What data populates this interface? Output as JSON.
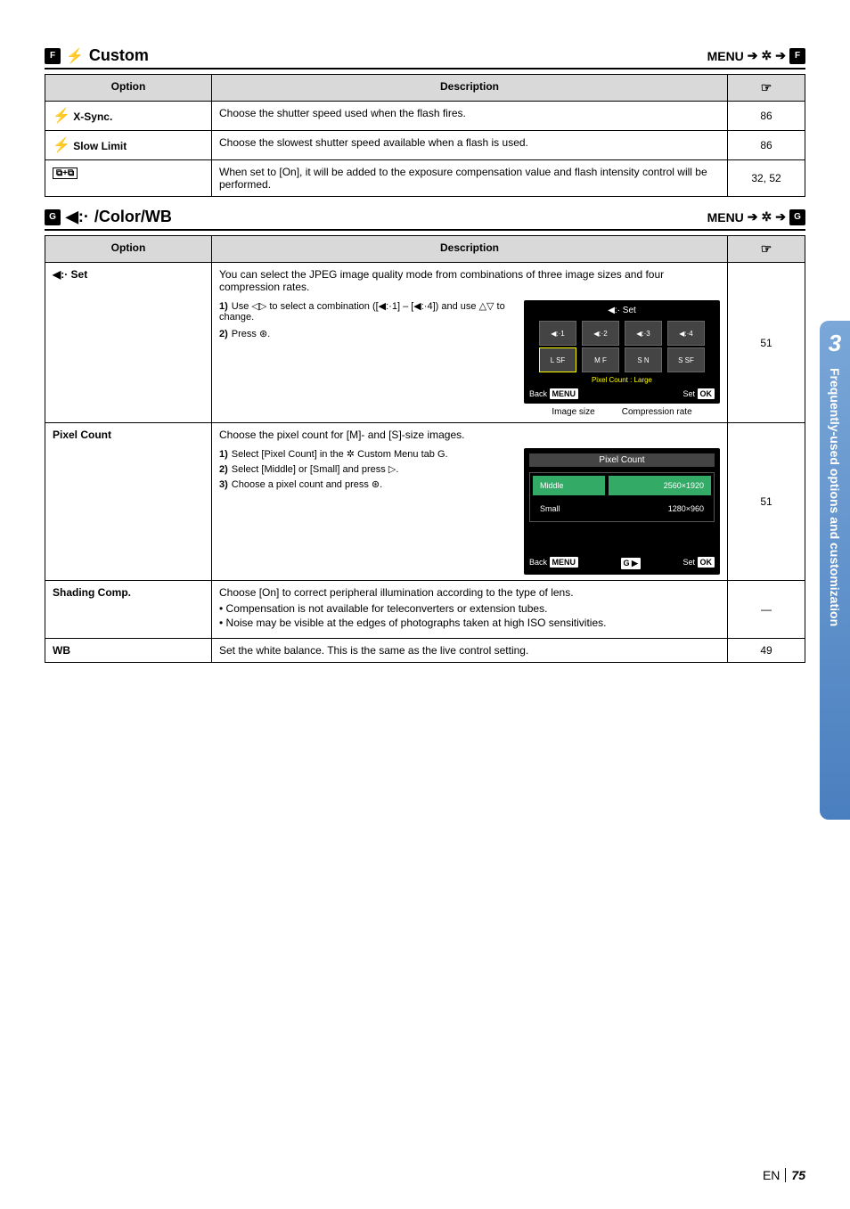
{
  "sectionF": {
    "tabIcon": "F",
    "flashIcon": "⚡",
    "title": "Custom",
    "menu": {
      "text": "MENU",
      "wrench": "✲",
      "tabIcon": "F"
    },
    "headers": {
      "option": "Option",
      "description": "Description",
      "ref": "☞"
    },
    "rows": [
      {
        "optIcon": "⚡",
        "opt": "X-Sync.",
        "desc": "Choose the shutter speed used when the flash fires.",
        "ref": "86"
      },
      {
        "optIcon": "⚡",
        "opt": "Slow Limit",
        "desc": "Choose the slowest shutter speed available when a flash is used.",
        "ref": "86"
      },
      {
        "optIcon": "",
        "opt": "⧉+⧉",
        "desc": "When set to [On], it will be added to the exposure compensation value and flash intensity control will be performed.",
        "ref": "32, 52"
      }
    ]
  },
  "sectionG": {
    "tabIcon": "G",
    "setIcon": "◀:·",
    "title": "/Color/WB",
    "menu": {
      "text": "MENU",
      "wrench": "✲",
      "tabIcon": "G"
    },
    "headers": {
      "option": "Option",
      "description": "Description",
      "ref": "☞"
    },
    "rows": {
      "set": {
        "opt": "◀:· Set",
        "desc": "You can select the JPEG image quality mode from combinations of three image sizes and four compression rates.",
        "steps": [
          {
            "n": "1)",
            "t": "Use ◁▷ to select a combination ([◀:·1] – [◀:·4]) and use △▽ to change."
          },
          {
            "n": "2)",
            "t": "Press ⊛."
          }
        ],
        "screen": {
          "title": "◀:· Set",
          "cells": [
            "◀:·1",
            "◀:·2",
            "◀:·3",
            "◀:·4",
            "L SF",
            "M F",
            "S N",
            "S SF"
          ],
          "pixelLine": "Pixel Count : Large",
          "back": "Back",
          "backBtn": "MENU",
          "set": "Set",
          "setBtn": "OK"
        },
        "captions": {
          "left": "Image size",
          "right": "Compression rate"
        },
        "ref": "51"
      },
      "pixelCount": {
        "opt": "Pixel Count",
        "desc": "Choose the pixel count for [M]- and [S]-size images.",
        "steps": [
          {
            "n": "1)",
            "t": "Select [Pixel Count] in the ✲ Custom Menu tab G."
          },
          {
            "n": "2)",
            "t": "Select [Middle] or [Small] and press ▷."
          },
          {
            "n": "3)",
            "t": "Choose a pixel count and press ⊛."
          }
        ],
        "screen": {
          "title": "Pixel Count",
          "rows": [
            {
              "l": "Middle",
              "r": "2560×1920",
              "sel": true
            },
            {
              "l": "Small",
              "r": "1280×960",
              "sel": false
            }
          ],
          "back": "Back",
          "backBtn": "MENU",
          "mid": "G ▶",
          "set": "Set",
          "setBtn": "OK"
        },
        "ref": "51"
      },
      "shading": {
        "opt": "Shading Comp.",
        "desc": "Choose [On] to correct peripheral illumination according to the type of lens.",
        "bullets": [
          "Compensation is not available for teleconverters or extension tubes.",
          "Noise may be visible at the edges of photographs taken at high ISO sensitivities."
        ],
        "ref": "—"
      },
      "wb": {
        "opt": "WB",
        "desc": "Set the white balance. This is the same as the live control setting.",
        "ref": "49"
      }
    }
  },
  "sidebar": {
    "num": "3",
    "text": "Frequently-used options and customization"
  },
  "footer": {
    "lang": "EN",
    "page": "75"
  }
}
